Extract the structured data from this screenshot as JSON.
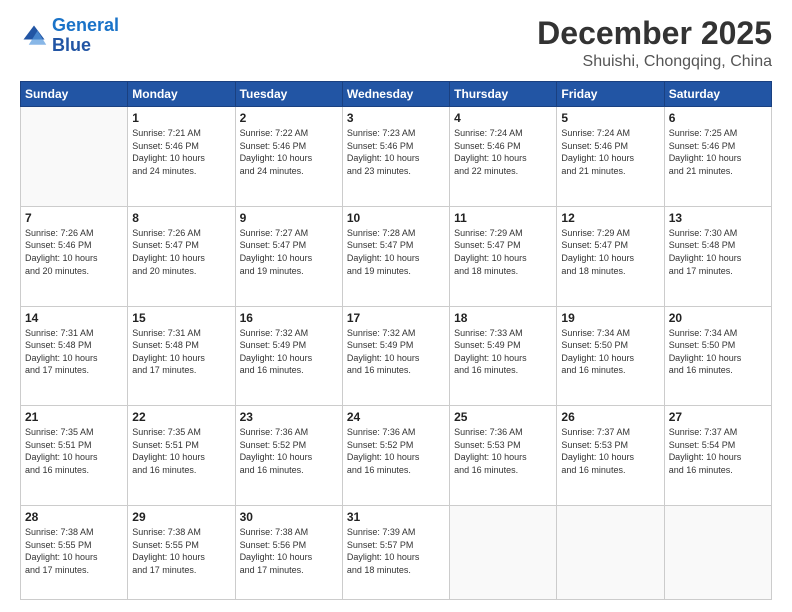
{
  "logo": {
    "line1": "General",
    "line2": "Blue"
  },
  "header": {
    "month": "December 2025",
    "location": "Shuishi, Chongqing, China"
  },
  "weekdays": [
    "Sunday",
    "Monday",
    "Tuesday",
    "Wednesday",
    "Thursday",
    "Friday",
    "Saturday"
  ],
  "weeks": [
    [
      {
        "day": "",
        "info": ""
      },
      {
        "day": "1",
        "info": "Sunrise: 7:21 AM\nSunset: 5:46 PM\nDaylight: 10 hours\nand 24 minutes."
      },
      {
        "day": "2",
        "info": "Sunrise: 7:22 AM\nSunset: 5:46 PM\nDaylight: 10 hours\nand 24 minutes."
      },
      {
        "day": "3",
        "info": "Sunrise: 7:23 AM\nSunset: 5:46 PM\nDaylight: 10 hours\nand 23 minutes."
      },
      {
        "day": "4",
        "info": "Sunrise: 7:24 AM\nSunset: 5:46 PM\nDaylight: 10 hours\nand 22 minutes."
      },
      {
        "day": "5",
        "info": "Sunrise: 7:24 AM\nSunset: 5:46 PM\nDaylight: 10 hours\nand 21 minutes."
      },
      {
        "day": "6",
        "info": "Sunrise: 7:25 AM\nSunset: 5:46 PM\nDaylight: 10 hours\nand 21 minutes."
      }
    ],
    [
      {
        "day": "7",
        "info": "Sunrise: 7:26 AM\nSunset: 5:46 PM\nDaylight: 10 hours\nand 20 minutes."
      },
      {
        "day": "8",
        "info": "Sunrise: 7:26 AM\nSunset: 5:47 PM\nDaylight: 10 hours\nand 20 minutes."
      },
      {
        "day": "9",
        "info": "Sunrise: 7:27 AM\nSunset: 5:47 PM\nDaylight: 10 hours\nand 19 minutes."
      },
      {
        "day": "10",
        "info": "Sunrise: 7:28 AM\nSunset: 5:47 PM\nDaylight: 10 hours\nand 19 minutes."
      },
      {
        "day": "11",
        "info": "Sunrise: 7:29 AM\nSunset: 5:47 PM\nDaylight: 10 hours\nand 18 minutes."
      },
      {
        "day": "12",
        "info": "Sunrise: 7:29 AM\nSunset: 5:47 PM\nDaylight: 10 hours\nand 18 minutes."
      },
      {
        "day": "13",
        "info": "Sunrise: 7:30 AM\nSunset: 5:48 PM\nDaylight: 10 hours\nand 17 minutes."
      }
    ],
    [
      {
        "day": "14",
        "info": "Sunrise: 7:31 AM\nSunset: 5:48 PM\nDaylight: 10 hours\nand 17 minutes."
      },
      {
        "day": "15",
        "info": "Sunrise: 7:31 AM\nSunset: 5:48 PM\nDaylight: 10 hours\nand 17 minutes."
      },
      {
        "day": "16",
        "info": "Sunrise: 7:32 AM\nSunset: 5:49 PM\nDaylight: 10 hours\nand 16 minutes."
      },
      {
        "day": "17",
        "info": "Sunrise: 7:32 AM\nSunset: 5:49 PM\nDaylight: 10 hours\nand 16 minutes."
      },
      {
        "day": "18",
        "info": "Sunrise: 7:33 AM\nSunset: 5:49 PM\nDaylight: 10 hours\nand 16 minutes."
      },
      {
        "day": "19",
        "info": "Sunrise: 7:34 AM\nSunset: 5:50 PM\nDaylight: 10 hours\nand 16 minutes."
      },
      {
        "day": "20",
        "info": "Sunrise: 7:34 AM\nSunset: 5:50 PM\nDaylight: 10 hours\nand 16 minutes."
      }
    ],
    [
      {
        "day": "21",
        "info": "Sunrise: 7:35 AM\nSunset: 5:51 PM\nDaylight: 10 hours\nand 16 minutes."
      },
      {
        "day": "22",
        "info": "Sunrise: 7:35 AM\nSunset: 5:51 PM\nDaylight: 10 hours\nand 16 minutes."
      },
      {
        "day": "23",
        "info": "Sunrise: 7:36 AM\nSunset: 5:52 PM\nDaylight: 10 hours\nand 16 minutes."
      },
      {
        "day": "24",
        "info": "Sunrise: 7:36 AM\nSunset: 5:52 PM\nDaylight: 10 hours\nand 16 minutes."
      },
      {
        "day": "25",
        "info": "Sunrise: 7:36 AM\nSunset: 5:53 PM\nDaylight: 10 hours\nand 16 minutes."
      },
      {
        "day": "26",
        "info": "Sunrise: 7:37 AM\nSunset: 5:53 PM\nDaylight: 10 hours\nand 16 minutes."
      },
      {
        "day": "27",
        "info": "Sunrise: 7:37 AM\nSunset: 5:54 PM\nDaylight: 10 hours\nand 16 minutes."
      }
    ],
    [
      {
        "day": "28",
        "info": "Sunrise: 7:38 AM\nSunset: 5:55 PM\nDaylight: 10 hours\nand 17 minutes."
      },
      {
        "day": "29",
        "info": "Sunrise: 7:38 AM\nSunset: 5:55 PM\nDaylight: 10 hours\nand 17 minutes."
      },
      {
        "day": "30",
        "info": "Sunrise: 7:38 AM\nSunset: 5:56 PM\nDaylight: 10 hours\nand 17 minutes."
      },
      {
        "day": "31",
        "info": "Sunrise: 7:39 AM\nSunset: 5:57 PM\nDaylight: 10 hours\nand 18 minutes."
      },
      {
        "day": "",
        "info": ""
      },
      {
        "day": "",
        "info": ""
      },
      {
        "day": "",
        "info": ""
      }
    ]
  ]
}
